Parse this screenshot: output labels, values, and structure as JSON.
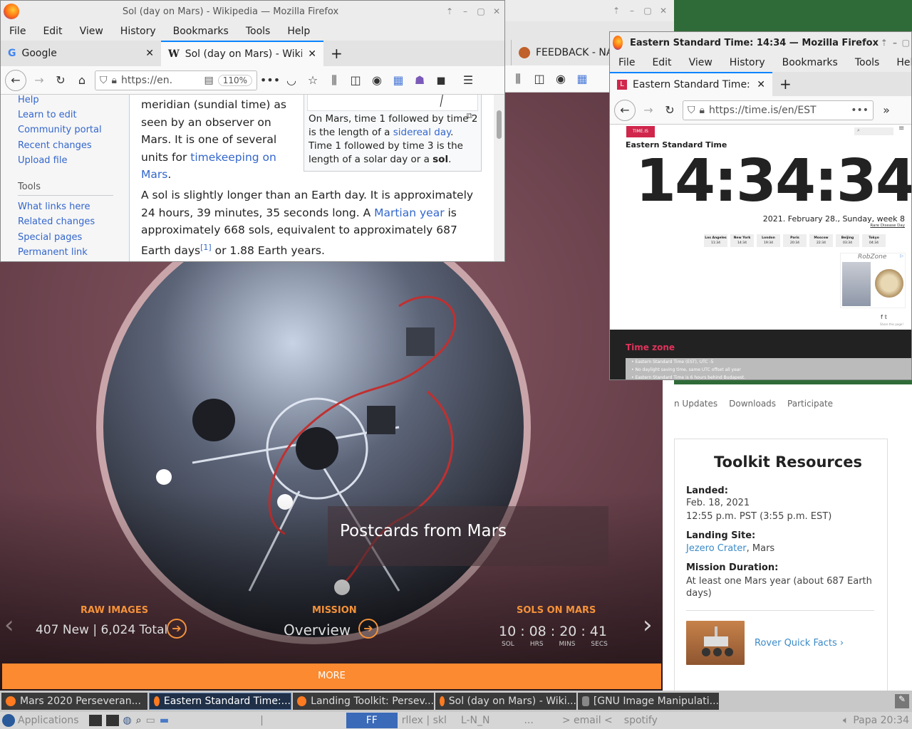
{
  "nasa": {
    "hero_title": "Postcards from Mars",
    "raw_label": "RAW IMAGES",
    "raw_value": "407 New | 6,024 Total",
    "mission_label": "MISSION",
    "mission_value": "Overview",
    "sols_label": "SOLS ON MARS",
    "sol": "10",
    "hrs": "08",
    "mins": "20",
    "secs": "41",
    "sol_u": "SOL",
    "hrs_u": "HRS",
    "mins_u": "MINS",
    "secs_u": "SECS",
    "more": "MORE",
    "nav1": "n Updates",
    "nav2": "Downloads",
    "nav3": "Participate",
    "toolkit_title": "Toolkit Resources",
    "landed_label": "Landed:",
    "landed_date": "Feb. 18, 2021",
    "landed_time": "12:55 p.m. PST (3:55 p.m. EST)",
    "site_label": "Landing Site:",
    "site_link": "Jezero Crater",
    "site_rest": ", Mars",
    "duration_label": "Mission Duration:",
    "duration_text": "At least one Mars year (about 687 Earth days)",
    "rover_link": "Rover Quick Facts ›"
  },
  "bgwin": {
    "feedback_tab": "FEEDBACK - NA"
  },
  "wiki": {
    "title": "Sol (day on Mars) - Wikipedia — Mozilla Firefox",
    "menu": [
      "File",
      "Edit",
      "View",
      "History",
      "Bookmarks",
      "Tools",
      "Help"
    ],
    "tab1": "Google",
    "tab2": "Sol (day on Mars) - Wikip",
    "url": "https://en.",
    "zoom": "110%",
    "side1": [
      "Help",
      "Learn to edit",
      "Community portal",
      "Recent changes",
      "Upload file"
    ],
    "tools_heading": "Tools",
    "side2": [
      "What links here",
      "Related changes",
      "Special pages",
      "Permanent link"
    ],
    "p1_a": "meridian (sundial time) as seen by an observer on Mars. It is one of several units for ",
    "p1_link": "timekeeping on Mars",
    "p1_b": ".",
    "cap_a": "On Mars, time 1 followed by time 2 is the length of a ",
    "cap_link": "sidereal day",
    "cap_b": ". Time 1 followed by time 3 is the length of a solar day or a ",
    "cap_bold": "sol",
    "cap_c": ".",
    "p2_a": "A sol is slightly longer than an Earth day. It is approximately 24 hours, 39 minutes, 35 seconds long. A ",
    "p2_link": "Martian year",
    "p2_b": " is approximately 668 sols, equivalent to approximately 687 Earth days",
    "p2_ref": "[1]",
    "p2_c": " or 1.88 Earth years."
  },
  "timeis": {
    "title": "Eastern Standard Time: 14:34 — Mozilla Firefox",
    "menu": [
      "File",
      "Edit",
      "View",
      "History",
      "Bookmarks",
      "Tools",
      "Help"
    ],
    "tab": "Eastern Standard Time:",
    "url": "https://time.is/en/EST",
    "logo": "TIME.IS",
    "zone": "Eastern Standard Time",
    "clock": "14:34:34",
    "date": "2021. February 28., Sunday, week 8",
    "rare": "Rare Disease Day",
    "cities": [
      {
        "n": "Los Angeles",
        "t": "11:34"
      },
      {
        "n": "New York",
        "t": "14:34"
      },
      {
        "n": "London",
        "t": "19:34"
      },
      {
        "n": "Paris",
        "t": "20:34"
      },
      {
        "n": "Moscow",
        "t": "22:34"
      },
      {
        "n": "Beijing",
        "t": "03:34"
      },
      {
        "n": "Tokyo",
        "t": "04:34"
      }
    ],
    "ad_brand": "RobZone",
    "share": "Share this page!",
    "tz_heading": "Time zone",
    "tz1": "Eastern Standard Time (EST), UTC -5",
    "tz2": "No daylight saving time, same UTC offset all year",
    "tz3": "Eastern Standard Time is 6 hours behind Budapest."
  },
  "taskbar": {
    "items": [
      "Mars 2020 Perseveran...",
      "Eastern Standard Time:...",
      "Landing Toolkit: Persev...",
      "Sol (day on Mars) - Wiki...",
      "[GNU Image Manipulati..."
    ]
  },
  "panel": {
    "apps": "Applications",
    "ff": "FF",
    "ws1": "rllex | skl",
    "ws2": "L-N_N",
    "ws3": "...",
    "email": "> email <",
    "spotify": "spotify",
    "clock": "Papa 20:34"
  }
}
